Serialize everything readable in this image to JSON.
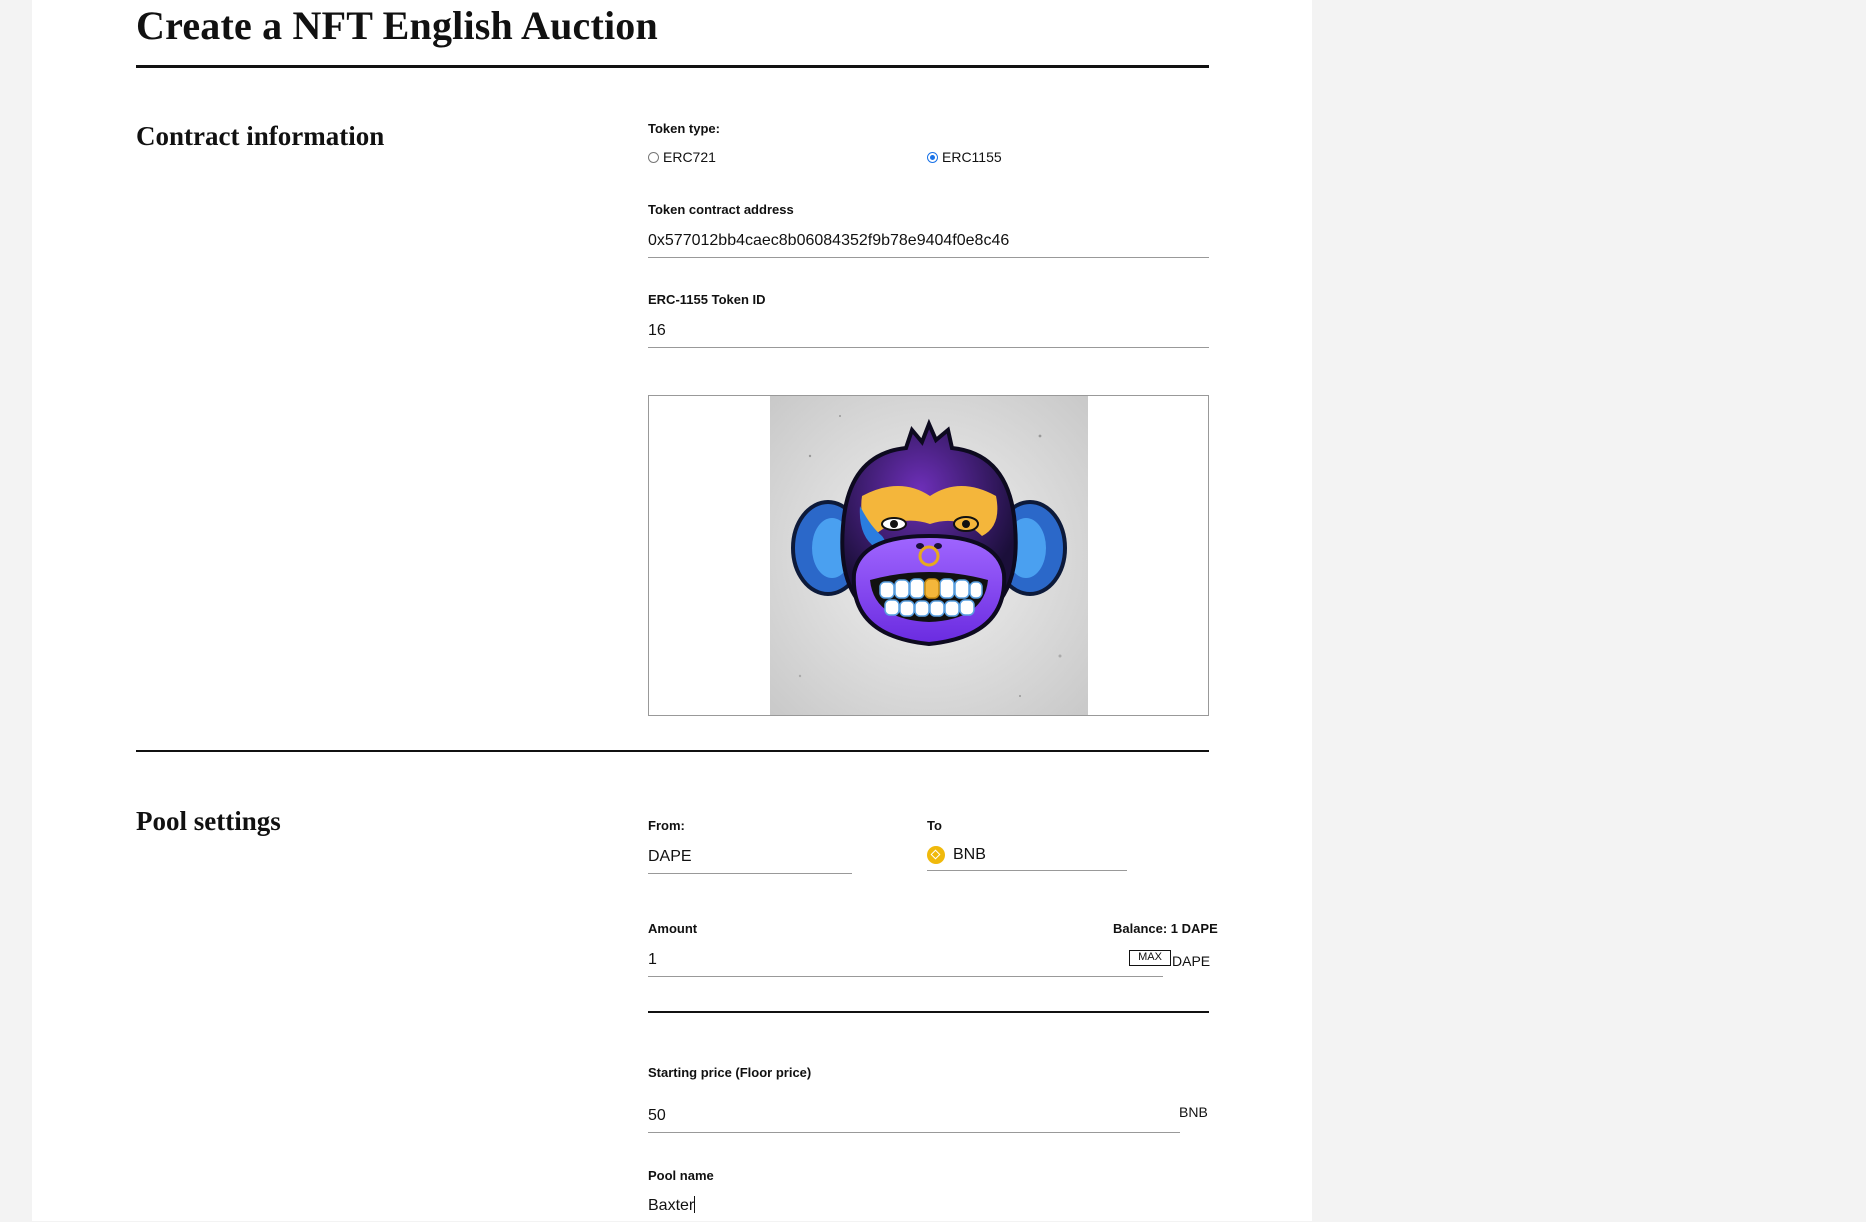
{
  "page": {
    "title": "Create a NFT English Auction"
  },
  "contract": {
    "section_title": "Contract information",
    "token_type_label": "Token type:",
    "token_types": [
      {
        "label": "ERC721",
        "selected": false
      },
      {
        "label": "ERC1155",
        "selected": true
      }
    ],
    "address_label": "Token contract address",
    "address_value": "0x577012bb4caec8b06084352f9b78e9404f0e8c46",
    "token_id_label": "ERC-1155 Token ID",
    "token_id_value": "16"
  },
  "pool": {
    "section_title": "Pool settings",
    "from_label": "From:",
    "from_value": "DAPE",
    "to_label": "To",
    "to_value": "BNB",
    "to_icon": "bnb-coin-icon",
    "amount_label": "Amount",
    "balance_text": "Balance: 1 DAPE",
    "amount_value": "1",
    "max_label": "MAX",
    "amount_unit": "DAPE",
    "starting_price_label": "Starting price (Floor price)",
    "starting_price_value": "50",
    "starting_price_unit": "BNB",
    "pool_name_label": "Pool name",
    "pool_name_value": "Baxter"
  },
  "colors": {
    "accent_radio": "#1a73e8",
    "bnb": "#f0b90b"
  }
}
